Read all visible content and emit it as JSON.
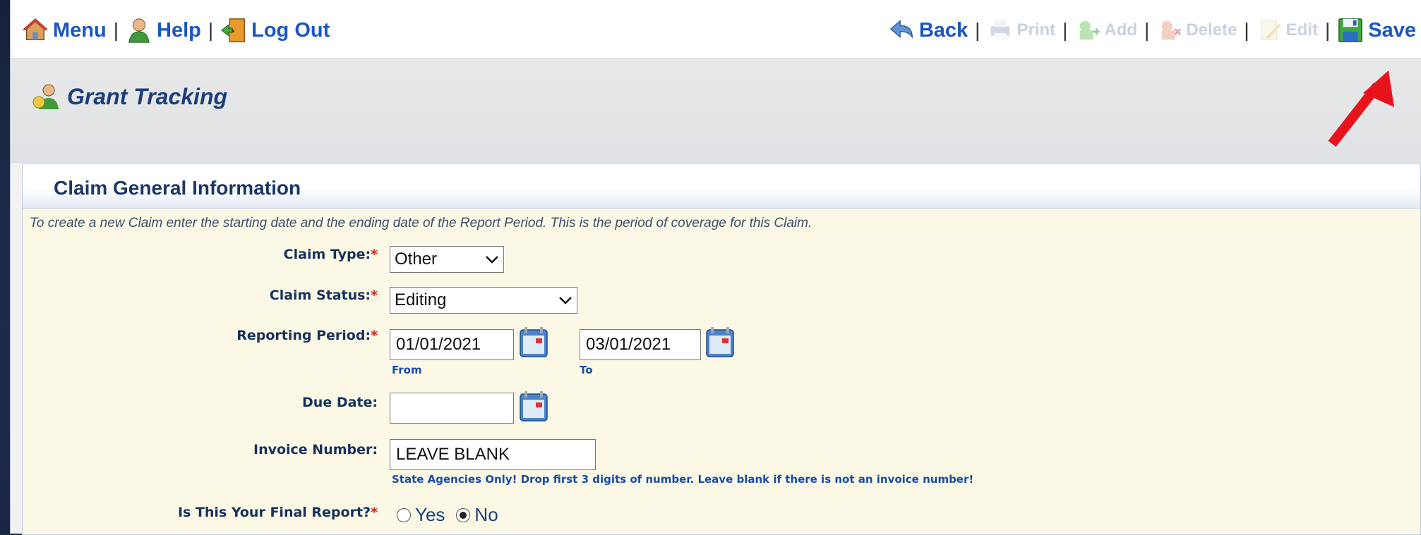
{
  "toolbar": {
    "menu_label": "Menu",
    "help_label": "Help",
    "logout_label": "Log Out",
    "back_label": "Back",
    "print_label": "Print",
    "add_label": "Add",
    "delete_label": "Delete",
    "edit_label": "Edit",
    "save_label": "Save",
    "separator": "|"
  },
  "page": {
    "title": "Grant Tracking"
  },
  "section": {
    "title": "Claim General Information",
    "instructions": "To create a new Claim enter the starting date and the ending date of the Report Period. This is the period of coverage for this Claim."
  },
  "form": {
    "required_marker": "*",
    "claim_type": {
      "label": "Claim Type:",
      "value": "Other"
    },
    "claim_status": {
      "label": "Claim Status:",
      "value": "Editing"
    },
    "reporting_period": {
      "label": "Reporting Period:",
      "from_value": "01/01/2021",
      "to_value": "03/01/2021",
      "from_caption": "From",
      "to_caption": "To"
    },
    "due_date": {
      "label": "Due Date:",
      "value": ""
    },
    "invoice_number": {
      "label": "Invoice Number:",
      "value": "LEAVE BLANK",
      "hint": "State Agencies Only! Drop first 3 digits of number. Leave blank if there is not an invoice number!"
    },
    "final_report": {
      "label": "Is This Your Final Report?",
      "option_yes": "Yes",
      "option_no": "No",
      "selected": "No"
    }
  },
  "colors": {
    "link_blue": "#1a56c4",
    "title_blue": "#1b3f7a",
    "section_bg": "#fbf9e6",
    "required_red": "#dd2222",
    "annotation_arrow": "#e8141b"
  },
  "icons": [
    "house-icon",
    "help-person-icon",
    "door-exit-icon",
    "back-arrow-icon",
    "print-icon",
    "add-icon",
    "delete-icon",
    "edit-icon",
    "save-disk-icon",
    "grant-people-icon",
    "calendar-icon",
    "chevron-down-icon"
  ]
}
